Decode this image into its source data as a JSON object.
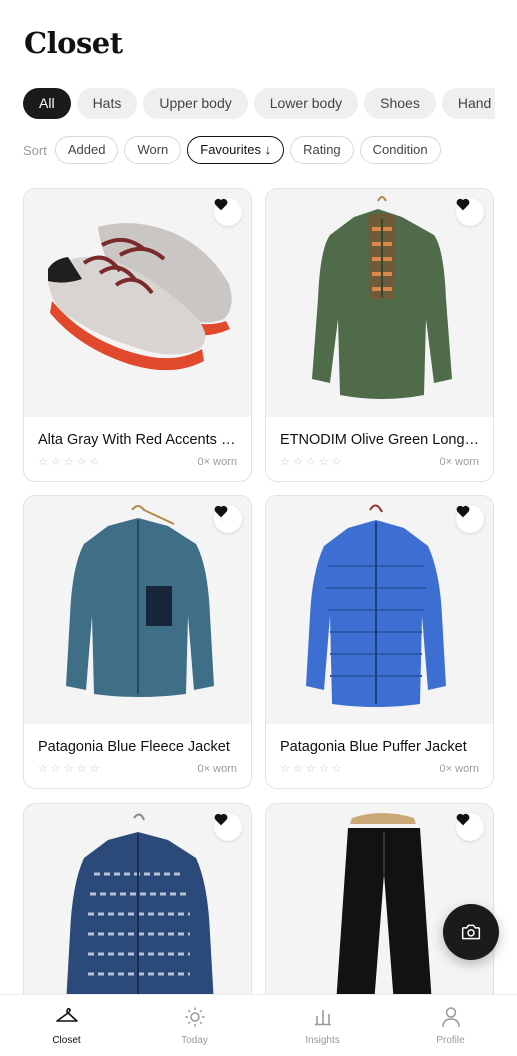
{
  "page": {
    "title": "Closet"
  },
  "categories": [
    {
      "label": "All",
      "active": true
    },
    {
      "label": "Hats",
      "active": false
    },
    {
      "label": "Upper body",
      "active": false
    },
    {
      "label": "Lower body",
      "active": false
    },
    {
      "label": "Shoes",
      "active": false
    },
    {
      "label": "Hand",
      "active": false
    }
  ],
  "sort": {
    "label": "Sort",
    "options": [
      {
        "label": "Added",
        "active": false
      },
      {
        "label": "Worn",
        "active": false
      },
      {
        "label": "Favourites ↓",
        "active": true
      },
      {
        "label": "Rating",
        "active": false
      },
      {
        "label": "Condition",
        "active": false
      }
    ]
  },
  "items": [
    {
      "name": "Alta Gray With Red Accents Running Shoes",
      "stars": "☆☆☆☆☆",
      "worn": "0× worn",
      "favourite": true,
      "image_icon": "shoe-image"
    },
    {
      "name": "ETNODIM Olive Green Long-Sleeve Tunic",
      "stars": "☆☆☆☆☆",
      "worn": "0× worn",
      "favourite": true,
      "image_icon": "tunic-image"
    },
    {
      "name": "Patagonia Blue Fleece Jacket",
      "stars": "☆☆☆☆☆",
      "worn": "0× worn",
      "favourite": true,
      "image_icon": "fleece-jacket-image"
    },
    {
      "name": "Patagonia Blue Puffer Jacket",
      "stars": "☆☆☆☆☆",
      "worn": "0× worn",
      "favourite": true,
      "image_icon": "puffer-jacket-image"
    },
    {
      "name": "",
      "stars": "",
      "worn": "",
      "favourite": true,
      "image_icon": "patterned-fleece-image"
    },
    {
      "name": "",
      "stars": "",
      "worn": "",
      "favourite": true,
      "image_icon": "black-pants-image"
    }
  ],
  "tabbar": {
    "tabs": [
      {
        "label": "Closet",
        "icon": "hanger-icon",
        "active": true
      },
      {
        "label": "Today",
        "icon": "sun-icon",
        "active": false
      },
      {
        "label": "Insights",
        "icon": "bar-chart-icon",
        "active": false
      },
      {
        "label": "Profile",
        "icon": "person-icon",
        "active": false
      }
    ]
  },
  "fab": {
    "icon": "camera-icon"
  },
  "colors": {
    "accent": "#1b1b1b",
    "chip_bg": "#efefef",
    "muted_text": "#9a9a9a",
    "card_border": "#e2e2e2"
  }
}
